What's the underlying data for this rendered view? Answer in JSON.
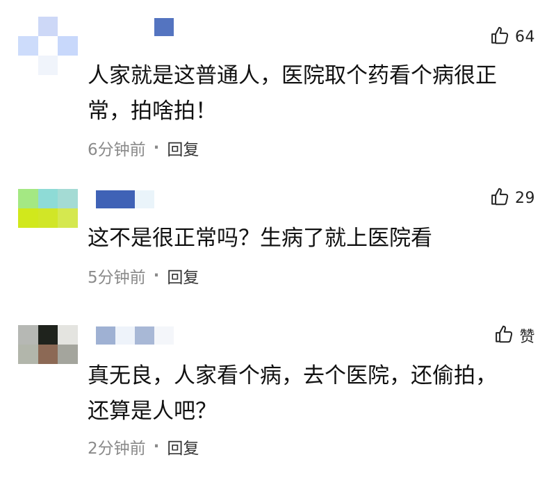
{
  "comments": [
    {
      "likes": "64",
      "text": "人家就是这普通人，医院取个药看个病很正\n常，拍啥拍！",
      "time": "6分钟前",
      "separator": "·",
      "reply": "回复",
      "avatar_colors": [
        "#ffffff",
        "#cdd8f7",
        "#ffffff",
        "#cddcfb",
        "#ffffff",
        "#c8d8fb",
        "#ffffff",
        "#f0f4fb",
        "#ffffff"
      ],
      "name_colors": [
        "#5474c0"
      ]
    },
    {
      "likes": "29",
      "text": "这不是很正常吗？生病了就上医院看",
      "time": "5分钟前",
      "separator": "·",
      "reply": "回复",
      "avatar_colors": [
        "#a4e883",
        "#8edbd6",
        "#a4dbd4",
        "#d1e81c",
        "#d1e627",
        "#d5e84f",
        "#ffffff",
        "#ffffff",
        "#ffffff"
      ],
      "name_colors": [
        "#3f62b6",
        "#3f62b6",
        "#eaf4fa"
      ]
    },
    {
      "likes": "赞",
      "text": "真无良，人家看个病，去个医院，还偷拍，\n还算是人吧？",
      "time": "2分钟前",
      "separator": "·",
      "reply": "回复",
      "avatar_colors": [
        "#b6b8b4",
        "#1f231d",
        "#e4e4e0",
        "#b2b6ab",
        "#8c6955",
        "#a4a59d",
        "#ffffff",
        "#ffffff",
        "#ffffff"
      ],
      "name_colors": [
        "#9fb1d3",
        "#eef3fa",
        "#a8b8d6",
        "#f4f6fa"
      ]
    }
  ]
}
